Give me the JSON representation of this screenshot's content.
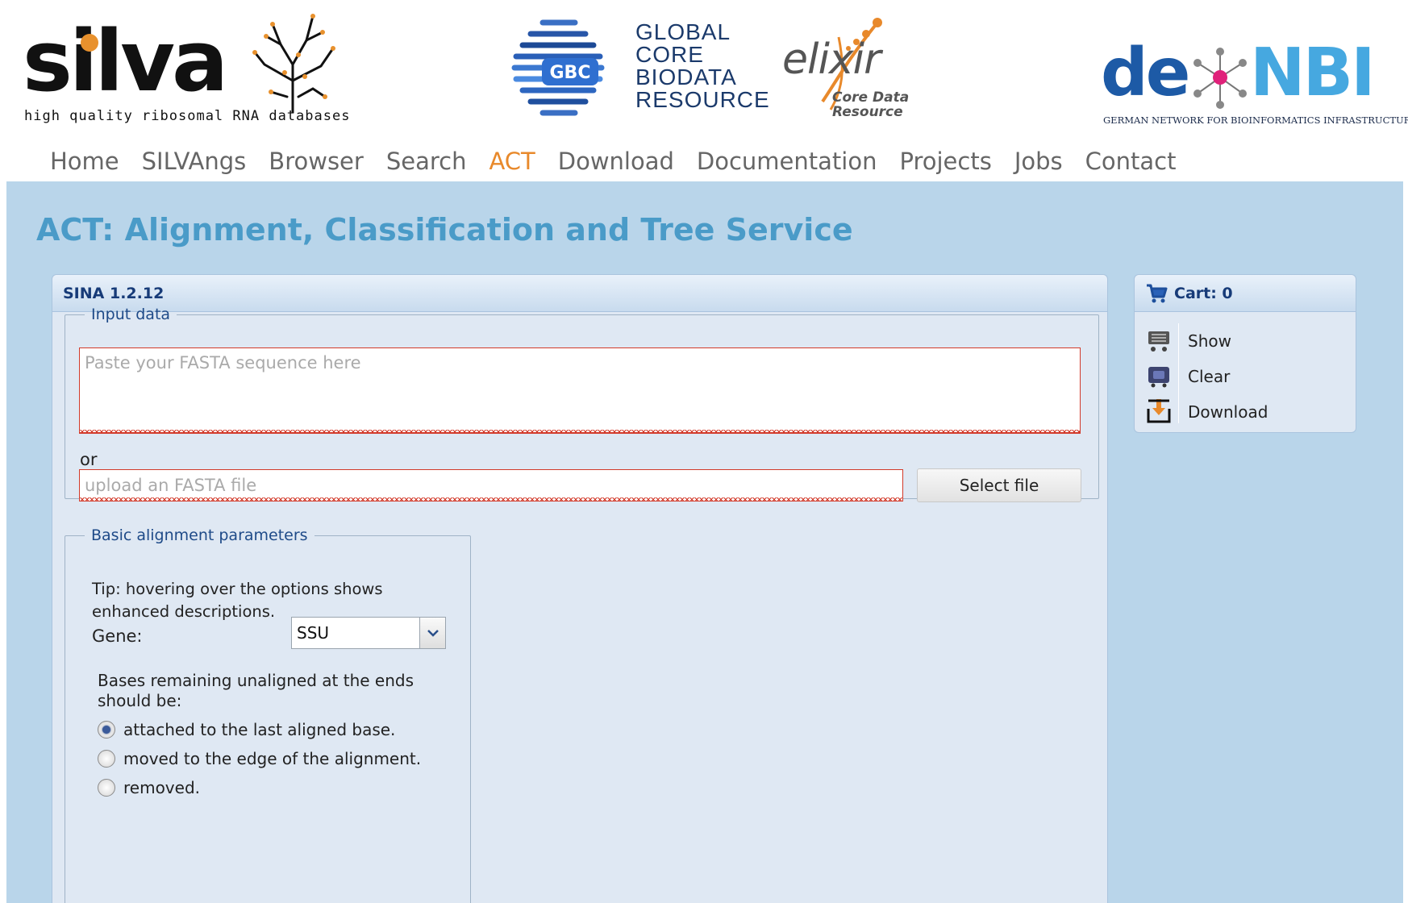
{
  "header": {
    "silva": {
      "word": "silva",
      "tagline": "high quality ribosomal RNA databases"
    },
    "gbc": {
      "badge": "GBC",
      "text": "GLOBAL\nCORE\nBIODATA\nRESOURCE"
    },
    "elixir": {
      "word": "elixir",
      "sub": "Core Data\nResource"
    },
    "denbi": {
      "de": "de",
      "nbi": "NBI",
      "sub": "GERMAN NETWORK FOR BIOINFORMATICS INFRASTRUCTURE"
    }
  },
  "nav": {
    "items": [
      {
        "label": "Home"
      },
      {
        "label": "SILVAngs"
      },
      {
        "label": "Browser"
      },
      {
        "label": "Search"
      },
      {
        "label": "ACT",
        "active": true
      },
      {
        "label": "Download"
      },
      {
        "label": "Documentation"
      },
      {
        "label": "Projects"
      },
      {
        "label": "Jobs"
      },
      {
        "label": "Contact"
      }
    ]
  },
  "page": {
    "title": "ACT: Alignment, Classification and Tree Service"
  },
  "sina": {
    "title": "SINA 1.2.12",
    "input": {
      "legend": "Input data",
      "textarea_placeholder": "Paste your FASTA sequence here",
      "or": "or",
      "file_placeholder": "upload an FASTA file",
      "select_file": "Select file"
    },
    "params": {
      "legend": "Basic alignment parameters",
      "tip": "Tip: hovering over the options shows enhanced descriptions.",
      "gene_label": "Gene:",
      "gene_value": "SSU",
      "bases_label": "Bases remaining unaligned at the ends should be:",
      "options": [
        {
          "label": "attached to the last aligned base.",
          "checked": true
        },
        {
          "label": "moved to the edge of the alignment.",
          "checked": false
        },
        {
          "label": "removed.",
          "checked": false
        }
      ]
    }
  },
  "cart": {
    "title": "Cart: 0",
    "items": [
      {
        "label": "Show",
        "icon": "cart-show-icon"
      },
      {
        "label": "Clear",
        "icon": "cart-clear-icon"
      },
      {
        "label": "Download",
        "icon": "cart-download-icon"
      }
    ]
  },
  "colors": {
    "accent_orange": "#e8892b",
    "title_blue": "#4a9bc8",
    "page_bg": "#b9d5ea",
    "panel_bg": "#dfe8f3",
    "error_red": "#d23a2a"
  }
}
